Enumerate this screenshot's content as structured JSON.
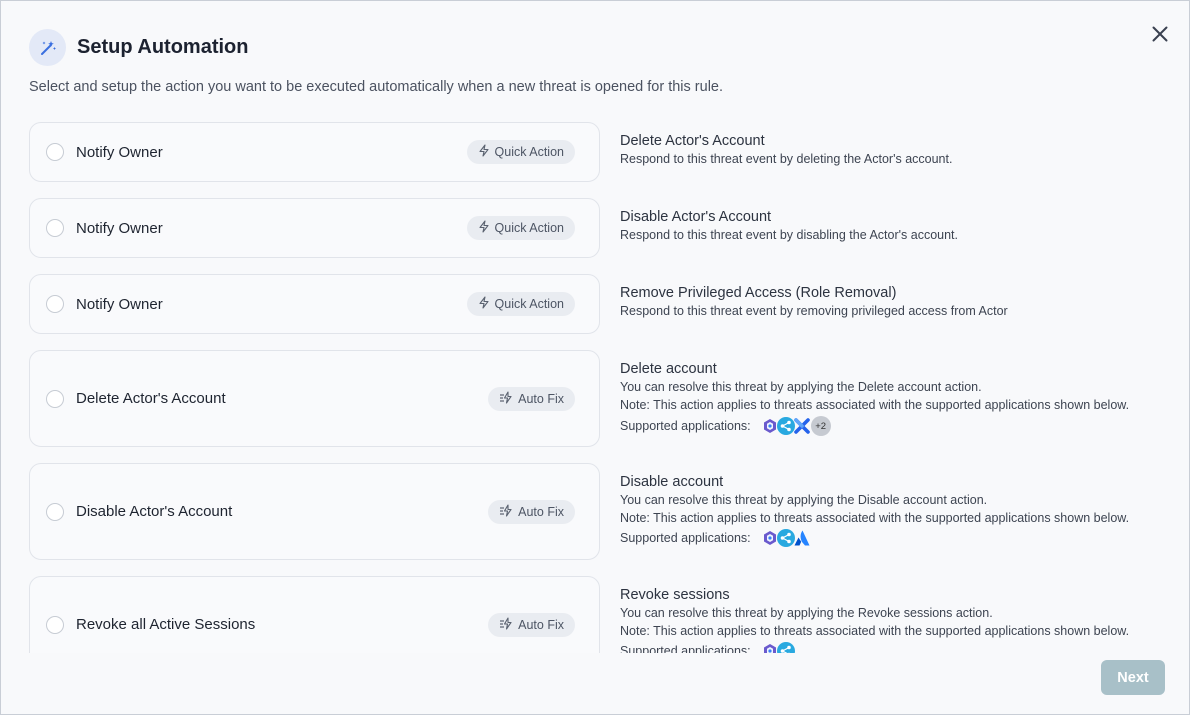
{
  "modal": {
    "title": "Setup Automation",
    "subtitle": "Select and setup the action you want to be executed automatically when a new threat is opened for this rule.",
    "icon": "magic-wand-icon",
    "close_icon": "close-icon"
  },
  "actions": [
    {
      "label": "Notify Owner",
      "badge": "Quick Action",
      "badge_icon": "lightning-icon",
      "title": "Delete Actor's Account",
      "lines": [
        "Respond to this threat event by deleting the Actor's account."
      ]
    },
    {
      "label": "Notify Owner",
      "badge": "Quick Action",
      "badge_icon": "lightning-icon",
      "title": "Disable Actor's Account",
      "lines": [
        "Respond to this threat event by disabling the Actor's account."
      ]
    },
    {
      "label": "Notify Owner",
      "badge": "Quick Action",
      "badge_icon": "lightning-icon",
      "title": "Remove Privileged Access (Role Removal)",
      "lines": [
        "Respond to this threat event by removing privileged access from Actor"
      ]
    },
    {
      "label": "Delete Actor's Account",
      "badge": "Auto Fix",
      "badge_icon": "auto-fix-icon",
      "title": "Delete account",
      "lines": [
        "You can resolve this threat by applying the Delete account action.",
        "Note: This action applies to threats associated with the supported applications shown below."
      ],
      "apps_label": "Supported applications:",
      "apps": [
        "hexagon-app-icon",
        "share-app-icon",
        "cross-app-icon"
      ],
      "apps_more": "+2"
    },
    {
      "label": "Disable Actor's Account",
      "badge": "Auto Fix",
      "badge_icon": "auto-fix-icon",
      "title": "Disable account",
      "lines": [
        "You can resolve this threat by applying the Disable account action.",
        "Note: This action applies to threats associated with the supported applications shown below."
      ],
      "apps_label": "Supported applications:",
      "apps": [
        "hexagon-app-icon",
        "share-app-icon",
        "atlassian-app-icon"
      ]
    },
    {
      "label": "Revoke all Active Sessions",
      "badge": "Auto Fix",
      "badge_icon": "auto-fix-icon",
      "title": "Revoke sessions",
      "lines": [
        "You can resolve this threat by applying the Revoke sessions action.",
        "Note: This action applies to threats associated with the supported applications shown below."
      ],
      "apps_label": "Supported applications:",
      "apps": [
        "hexagon-app-icon",
        "share-app-icon"
      ]
    }
  ],
  "footer": {
    "next_label": "Next",
    "next_color": "#a8c0c8"
  },
  "colors": {
    "accent": "#3a6fe0",
    "background": "#f8f9fb",
    "card_border": "#e1e4ea",
    "badge_bg": "#e9ecf1"
  }
}
